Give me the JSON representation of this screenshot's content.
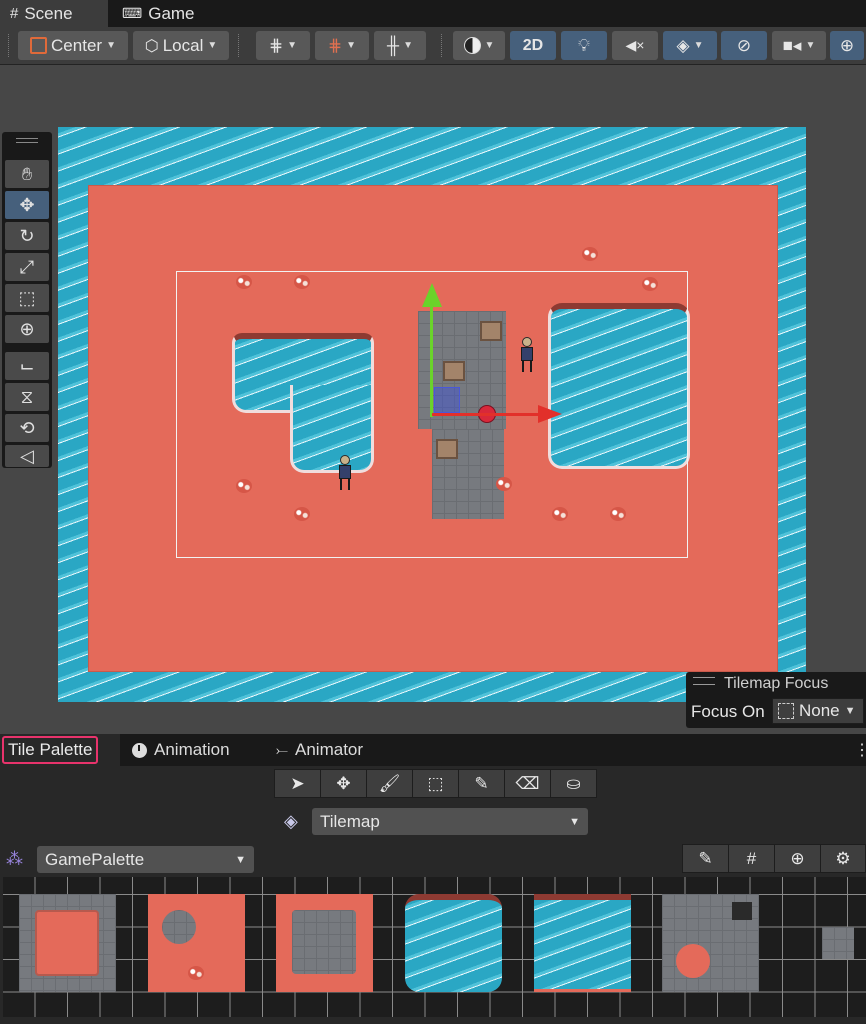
{
  "window_tabs": [
    {
      "label": "Scene",
      "icon": "hash-icon"
    },
    {
      "label": "Game",
      "icon": "gamepad-icon"
    }
  ],
  "toolbar": {
    "pivot_label": "Center",
    "space_label": "Local",
    "two_d_label": "2D"
  },
  "tilemap_focus": {
    "title": "Tilemap Focus",
    "focus_on_label": "Focus On",
    "value": "None"
  },
  "panel_tabs": [
    {
      "label": "Tile Palette",
      "icon": ""
    },
    {
      "label": "Animation",
      "icon": "clock-icon"
    },
    {
      "label": "Animator",
      "icon": "animator-icon"
    }
  ],
  "palette": {
    "active_tilemap": "Tilemap",
    "palette_name": "GamePalette"
  },
  "colors": {
    "accent_blue": "#46607c",
    "highlight_pink": "#e8336c",
    "ground": "#e46a5a",
    "water": "#2aa7c4"
  }
}
